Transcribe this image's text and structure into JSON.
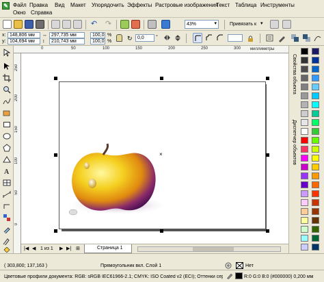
{
  "menu": {
    "items": [
      "Файл",
      "Правка",
      "Вид",
      "Макет",
      "Упорядочить",
      "Эффекты",
      "Растровые изображения",
      "Текст",
      "Таблица",
      "Инструменты",
      "Окно",
      "Справка"
    ]
  },
  "toolbar": {
    "zoom": "43%",
    "snap_label": "Привязать к"
  },
  "property_bar": {
    "x": "148,806 мм",
    "y": "104,694 мм",
    "width": "297,735 мм",
    "height": "210,743 мм",
    "scale_w": "100,0",
    "scale_h": "100,0",
    "scale_unit": "%",
    "angle": "0,0",
    "angle_unit": "°",
    "outline_width": "0,0"
  },
  "ruler": {
    "top_ticks": [
      "0",
      "50",
      "100",
      "150",
      "200",
      "250",
      "300"
    ],
    "unit": "миллиметры",
    "left_ticks": [
      "250",
      "200",
      "150",
      "100",
      "50",
      "0"
    ]
  },
  "dockers": {
    "tab1": "Свойства объекта",
    "tab2": "Диспетчер объектов"
  },
  "page_nav": {
    "counter": "1 из 1",
    "page_tab": "Страница 1"
  },
  "status": {
    "coords": "( 303,800; 137,163 )",
    "selection": "Прямоугольник вкл. Слой 1",
    "fill_none": "Нет",
    "color_profile": "Цветовые профили документа: RGB: sRGB IEC61966-2.1; CMYK: ISO Coated v2 (ECI); Оттенки серо...",
    "outline": "R:0 G:0 B:0 (#000000) 0,200 мм"
  },
  "palette_colors": [
    "#000000",
    "#1a1a66",
    "#333333",
    "#003399",
    "#4d4d4d",
    "#0066cc",
    "#666666",
    "#3399ff",
    "#808080",
    "#66ccff",
    "#999999",
    "#00ccff",
    "#b3b3b3",
    "#00ffff",
    "#cccccc",
    "#00cc99",
    "#e6e6e6",
    "#00ff66",
    "#ffffff",
    "#33cc33",
    "#ff0000",
    "#66ff00",
    "#ff3366",
    "#ccff00",
    "#ff00ff",
    "#ffff00",
    "#cc00cc",
    "#ffcc00",
    "#9933ff",
    "#ff9900",
    "#6600cc",
    "#ff6600",
    "#cc99ff",
    "#ff3300",
    "#ffccff",
    "#cc3300",
    "#ffcc99",
    "#993300",
    "#ffff99",
    "#663300",
    "#ccffcc",
    "#336600",
    "#99ffff",
    "#006633",
    "#ccccff",
    "#003366"
  ]
}
